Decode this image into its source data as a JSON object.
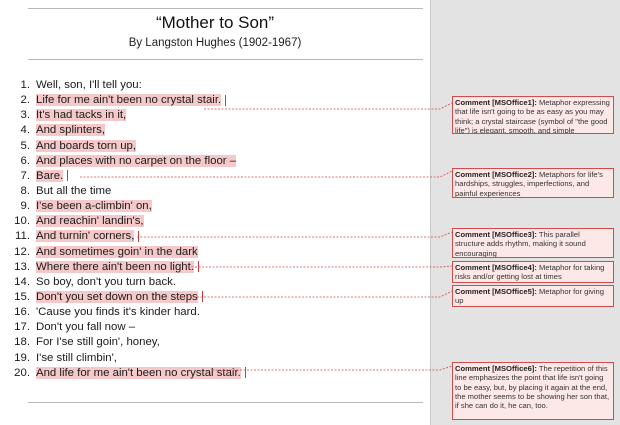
{
  "document": {
    "title": "“Mother to Son”",
    "byline": "By Langston Hughes (1902-1967)"
  },
  "poem": {
    "lines": [
      {
        "num": "1.",
        "text": "Well, son, I'll tell you:"
      },
      {
        "num": "2.",
        "text": "Life for me ain't been no crystal stair."
      },
      {
        "num": "3.",
        "text": "It's had tacks in it,"
      },
      {
        "num": "4.",
        "text": "And splinters,"
      },
      {
        "num": "5.",
        "text": "And boards torn up,"
      },
      {
        "num": "6.",
        "text": "And places with no carpet on the floor –"
      },
      {
        "num": "7.",
        "text": "Bare."
      },
      {
        "num": "8.",
        "text": "But all the time"
      },
      {
        "num": "9.",
        "text": "I'se been a-climbin' on,"
      },
      {
        "num": "10.",
        "text": "And reachin' landin's,"
      },
      {
        "num": "11.",
        "text": "And turnin' corners,"
      },
      {
        "num": "12.",
        "text": "And sometimes goin' in the dark"
      },
      {
        "num": "13.",
        "text": "Where there ain't been no light."
      },
      {
        "num": "14.",
        "text": "So boy, don't you turn back."
      },
      {
        "num": "15.",
        "text": "Don't you set down on the steps"
      },
      {
        "num": "16.",
        "text": "'Cause you finds it's kinder hard."
      },
      {
        "num": "17.",
        "text": "Don't you fall now –"
      },
      {
        "num": "18.",
        "text": "For I'se still goin', honey,"
      },
      {
        "num": "19.",
        "text": "I'se still climbin',"
      },
      {
        "num": "20.",
        "text": "And life for me ain't been no crystal stair."
      }
    ]
  },
  "comments": [
    {
      "author": "Comment [MSOffice1]:",
      "text": "Metaphor expressing that life isn't going to be as easy as you may think; a crystal staircase (symbol of \"the good life\") is elegant, smooth, and simple"
    },
    {
      "author": "Comment [MSOffice2]:",
      "text": "Metaphors for life's hardships, struggles, imperfections, and painful experiences"
    },
    {
      "author": "Comment [MSOffice3]:",
      "text": "This parallel structure adds rhythm, making it sound encouraging"
    },
    {
      "author": "Comment [MSOffice4]:",
      "text": "Metaphor for taking risks and/or getting lost at times"
    },
    {
      "author": "Comment [MSOffice5]:",
      "text": "Metaphor for giving up"
    },
    {
      "author": "Comment [MSOffice6]:",
      "text": "The repetition of this line emphasizes the point that life isn't going to be easy, but, by placing it again at the end, the mother seems to be showing her son that, if she can do it, he can, too."
    }
  ],
  "colors": {
    "highlight": "#f5c9c9",
    "comment_border": "#d24b4b",
    "comment_fill": "#fde8e8",
    "margin_pane": "#e3e3e3"
  }
}
